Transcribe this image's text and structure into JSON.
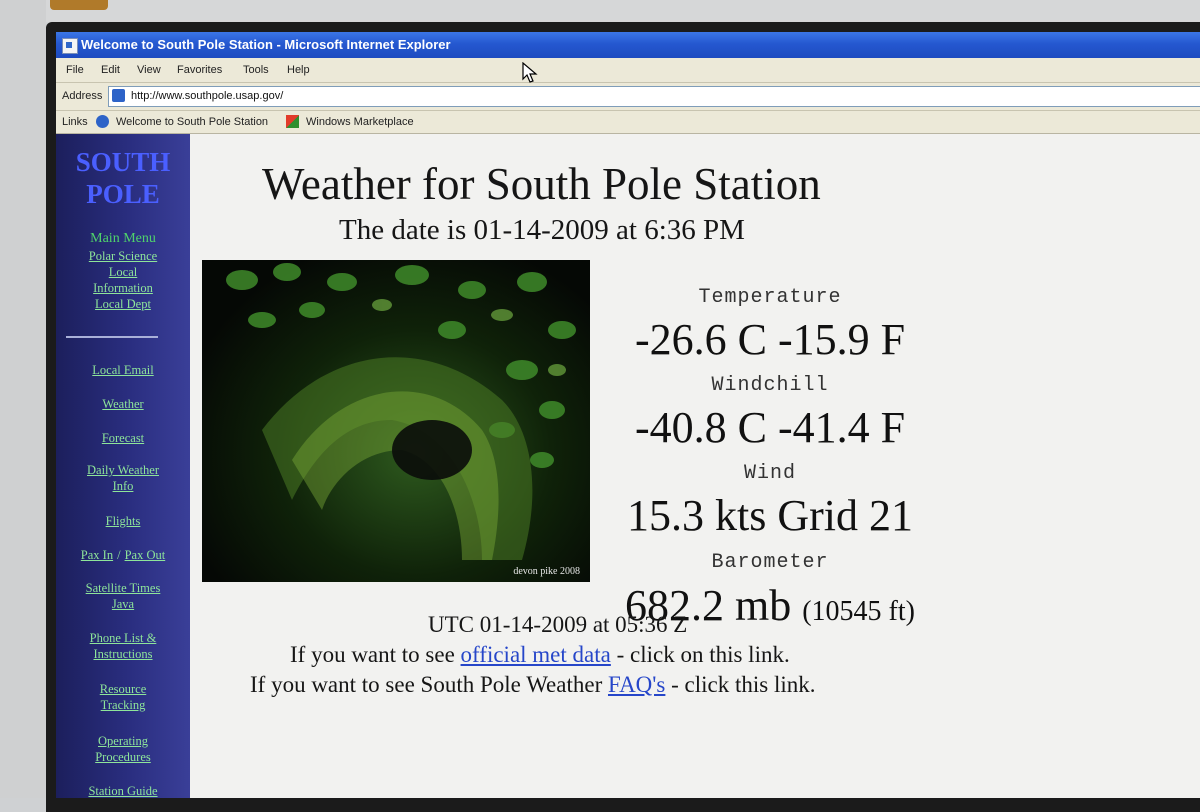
{
  "window": {
    "title": "Welcome to South Pole Station - Microsoft Internet Explorer"
  },
  "menubar": [
    "File",
    "Edit",
    "View",
    "Favorites",
    "Tools",
    "Help"
  ],
  "address": {
    "label": "Address",
    "url": "http://www.southpole.usap.gov/"
  },
  "links_bar": {
    "label": "Links",
    "items": [
      "Welcome to South Pole Station",
      "Windows Marketplace"
    ]
  },
  "sidebar": {
    "brand_line1": "SOUTH",
    "brand_line2": "POLE",
    "main_menu": "Main Menu",
    "top_links": [
      "Polar Science",
      "Local",
      "Information",
      "Local Dept"
    ],
    "links": [
      [
        "Local Email"
      ],
      [
        "Weather"
      ],
      [
        "Forecast"
      ],
      [
        "Daily Weather",
        "Info"
      ],
      [
        "Flights"
      ],
      [
        "Satellite Times",
        "Java"
      ],
      [
        "Phone List &",
        "Instructions"
      ],
      [
        "Resource",
        "Tracking"
      ],
      [
        "Operating",
        "Procedures"
      ],
      [
        "Station Guide"
      ]
    ],
    "pax_in": "Pax In",
    "pax_sep": "/",
    "pax_out": "Pax Out"
  },
  "content": {
    "title": "Weather for South Pole Station",
    "date_line": "The date is 01-14-2009 at 6:36 PM",
    "photo_credit": "devon pike 2008",
    "temperature_label": "Temperature",
    "temperature_value": "-26.6 C -15.9 F",
    "windchill_label": "Windchill",
    "windchill_value": "-40.8 C  -41.4 F",
    "wind_label": "Wind",
    "wind_value": "15.3 kts Grid 21",
    "barometer_label": "Barometer",
    "barometer_value": "682.2 mb",
    "barometer_altitude": "(10545 ft)",
    "utc_line": "UTC 01-14-2009 at 05:36 Z",
    "met_prefix": "If you want to see ",
    "met_link": "official met data",
    "met_suffix": " - click on this link.",
    "faq_prefix": "If you want to see South Pole Weather ",
    "faq_link": "FAQ's",
    "faq_suffix": " - click this link."
  }
}
